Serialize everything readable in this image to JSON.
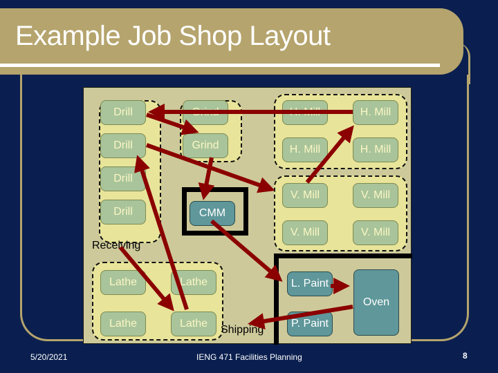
{
  "slide": {
    "title": "Example Job Shop Layout",
    "footer": {
      "date": "5/20/2021",
      "course": "IENG 471 Facilities Planning",
      "page_number": "8"
    }
  },
  "colors": {
    "background": "#0a1f4f",
    "accent_gold": "#b5a46d",
    "floor": "#cdc99a",
    "department_fill": "#e8e49a",
    "machine_fill": "#a9c49a",
    "special_machine_fill": "#5f979a",
    "flow_arrow": "#8b0000"
  },
  "layout": {
    "departments": [
      {
        "name": "Drill",
        "machines": [
          "Drill",
          "Drill",
          "Drill",
          "Drill"
        ]
      },
      {
        "name": "Grind",
        "machines": [
          "Grind",
          "Grind"
        ]
      },
      {
        "name": "H. Mill",
        "machines": [
          "H. Mill",
          "H. Mill",
          "H. Mill",
          "H. Mill"
        ]
      },
      {
        "name": "V. Mill",
        "machines": [
          "V. Mill",
          "V. Mill",
          "V. Mill",
          "V. Mill"
        ]
      },
      {
        "name": "Lathe",
        "machines": [
          "Lathe",
          "Lathe",
          "Lathe",
          "Lathe"
        ]
      }
    ],
    "inspection": {
      "machine": "CMM"
    },
    "paint_area": {
      "machines": [
        "L. Paint",
        "P. Paint",
        "Oven"
      ]
    },
    "labels": {
      "receiving": "Receiving",
      "shipping": "Shipping"
    },
    "flow": [
      {
        "from": "Receiving",
        "to": "Lathe"
      },
      {
        "from": "Lathe",
        "to": "Drill"
      },
      {
        "from": "H. Mill",
        "to": "Drill"
      },
      {
        "from": "Drill",
        "to": "Grind"
      },
      {
        "from": "Drill",
        "to": "V. Mill"
      },
      {
        "from": "V. Mill",
        "to": "H. Mill"
      },
      {
        "from": "Grind",
        "to": "CMM"
      },
      {
        "from": "CMM",
        "to": "L. Paint"
      },
      {
        "from": "L. Paint",
        "to": "Oven"
      },
      {
        "from": "Oven",
        "to": "Shipping"
      }
    ]
  }
}
